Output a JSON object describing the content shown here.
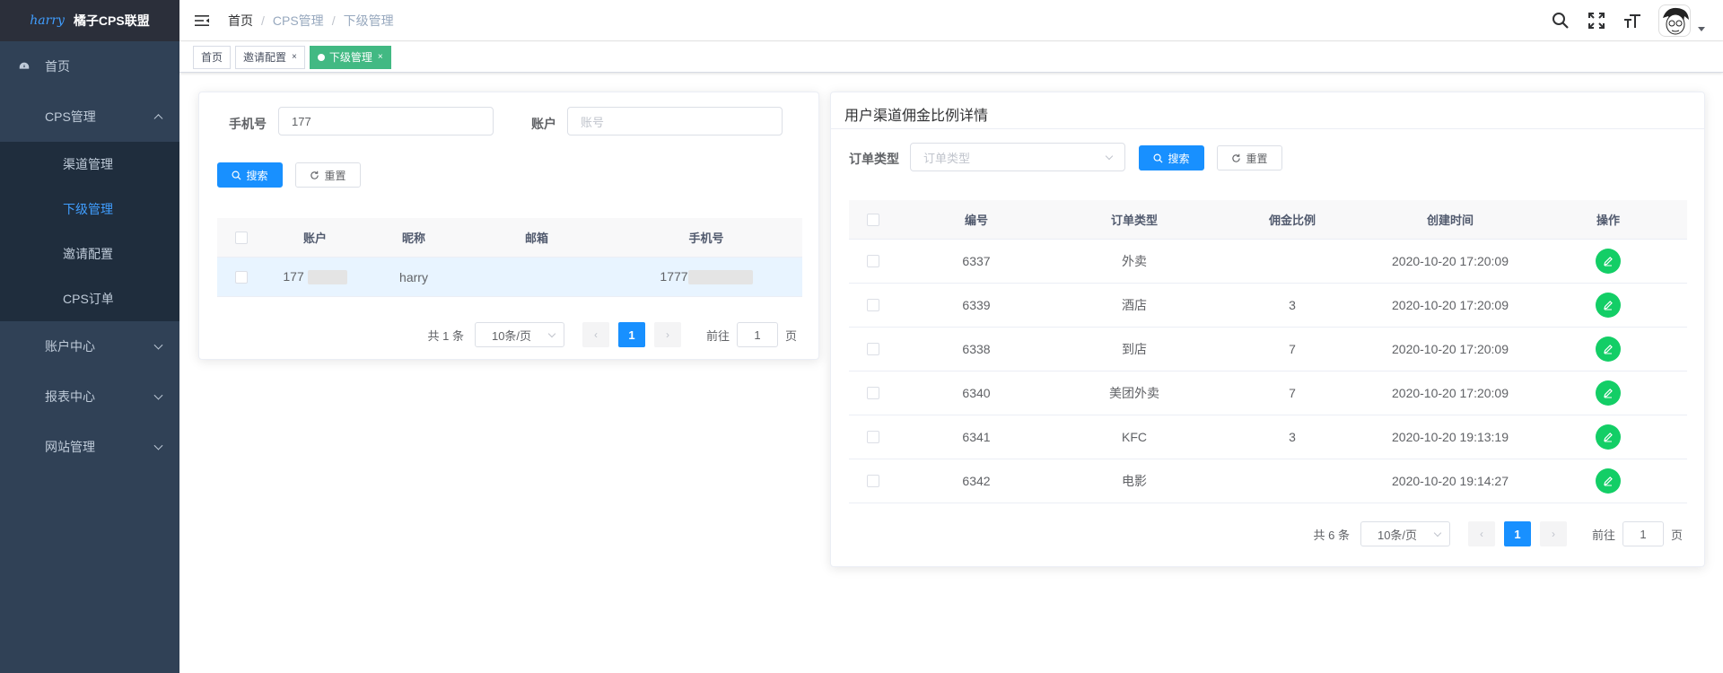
{
  "sidebar": {
    "logo_mark": "harry",
    "title": "橘子CPS联盟",
    "items": [
      {
        "label": "首页"
      },
      {
        "label": "CPS管理",
        "children": [
          {
            "label": "渠道管理"
          },
          {
            "label": "下级管理"
          },
          {
            "label": "邀请配置"
          },
          {
            "label": "CPS订单"
          }
        ]
      },
      {
        "label": "账户中心"
      },
      {
        "label": "报表中心"
      },
      {
        "label": "网站管理"
      }
    ]
  },
  "breadcrumb": [
    "首页",
    "CPS管理",
    "下级管理"
  ],
  "breadcrumb_sep": "/",
  "tags": [
    {
      "label": "首页"
    },
    {
      "label": "邀请配置",
      "close": "×"
    },
    {
      "label": "下级管理",
      "close": "×"
    }
  ],
  "left_panel": {
    "phone_label": "手机号",
    "phone_value": "177",
    "account_label": "账户",
    "account_placeholder": "账号",
    "search_label": "搜索",
    "reset_label": "重置",
    "columns": [
      "账户",
      "昵称",
      "邮箱",
      "手机号"
    ],
    "rows": [
      {
        "account": "177",
        "nickname": "harry",
        "email": "",
        "phone": "1777"
      }
    ],
    "pagination": {
      "total": "共 1 条",
      "page_size": "10条/页",
      "current": "1",
      "goto": "前往",
      "goto_value": "1",
      "page_unit": "页"
    }
  },
  "right_panel": {
    "title": "用户渠道佣金比例详情",
    "order_type_label": "订单类型",
    "order_type_placeholder": "订单类型",
    "search_label": "搜索",
    "reset_label": "重置",
    "columns": [
      "编号",
      "订单类型",
      "佣金比例",
      "创建时间",
      "操作"
    ],
    "rows": [
      {
        "id": "6337",
        "type": "外卖",
        "ratio": "",
        "created": "2020-10-20 17:20:09"
      },
      {
        "id": "6339",
        "type": "酒店",
        "ratio": "3",
        "created": "2020-10-20 17:20:09"
      },
      {
        "id": "6338",
        "type": "到店",
        "ratio": "7",
        "created": "2020-10-20 17:20:09"
      },
      {
        "id": "6340",
        "type": "美团外卖",
        "ratio": "7",
        "created": "2020-10-20 17:20:09"
      },
      {
        "id": "6341",
        "type": "KFC",
        "ratio": "3",
        "created": "2020-10-20 19:13:19"
      },
      {
        "id": "6342",
        "type": "电影",
        "ratio": "",
        "created": "2020-10-20 19:14:27"
      }
    ],
    "pagination": {
      "total": "共 6 条",
      "page_size": "10条/页",
      "current": "1",
      "goto": "前往",
      "goto_value": "1",
      "page_unit": "页"
    }
  },
  "colors": {
    "sidebar_bg": "#304156",
    "submenu_bg": "#1f2d3d",
    "primary": "#1890ff",
    "active_tag": "#42b983",
    "edit_button": "#13ce66"
  }
}
